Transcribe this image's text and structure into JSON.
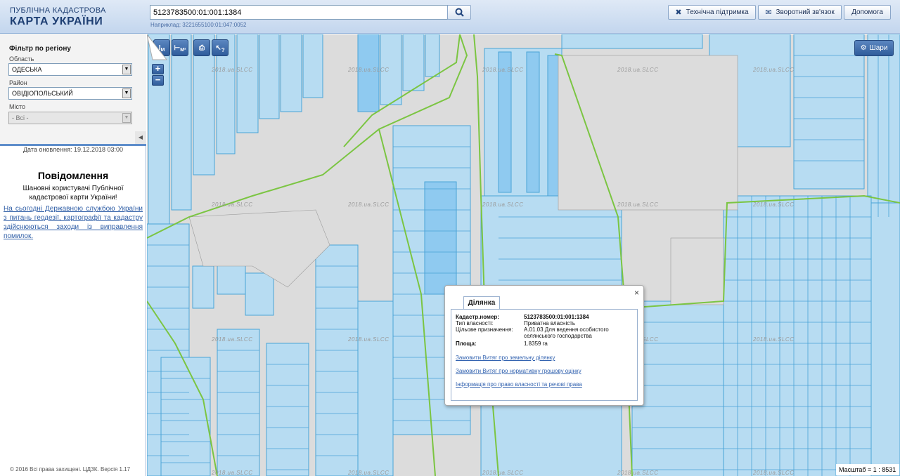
{
  "header": {
    "logo_line1": "ПУБЛІЧНА КАДАСТРОВА",
    "logo_line2": "КАРТА УКРАЇНИ",
    "search_value": "5123783500:01:001:1384",
    "search_hint": "Наприклад: 3221655100:01:047:0052",
    "buttons": {
      "support": "Технічна підтримка",
      "feedback": "Зворотний зв'язок",
      "help": "Допомога"
    }
  },
  "sidebar": {
    "filter_title": "Фільтр по регіону",
    "region_label": "Область",
    "region_value": "ОДЕСЬКА",
    "district_label": "Район",
    "district_value": "ОВІДІОПОЛЬСЬКИЙ",
    "city_label": "Місто",
    "city_value": "- Всі -",
    "update_date": "Дата оновлення: 19.12.2018 03:00",
    "message_title": "Повідомлення",
    "message_body": "Шановні користувачі Публічної кадастрової карти України!",
    "message_link": "На сьогодні Державною службою України з питань геодезії, картографії та кадастру здійснюються заходи із виправлення помилок.",
    "copyright": "© 2016 Всі права захищені. ЦДЗК. Версія 1.17"
  },
  "map": {
    "tools": {
      "measure_line_label": "M",
      "measure_area_label": "M²",
      "info_label": "?"
    },
    "zoom_in": "+",
    "zoom_out": "−",
    "layers_label": "Шари",
    "scale_text": "Масштаб = 1 : 8531",
    "watermark": "2018.ua.SLCC"
  },
  "popup": {
    "tab_label": "Ділянка",
    "close": "×",
    "fields": {
      "cadastral_label": "Кадастр.номер:",
      "cadastral_value": "5123783500:01:001:1384",
      "ownership_label": "Тип власності:",
      "ownership_value": "Приватна власність",
      "purpose_label": "Цільове призначення:",
      "purpose_value": "А.01.03 Для ведення особистого селянського господарства",
      "area_label": "Площа:",
      "area_value": "1.8359 га"
    },
    "links": {
      "extract": "Замовити Витяг про земельну ділянку",
      "valuation": "Замовити Витяг про нормативну грошову оцінку",
      "rights": "Інформація про право власності та речові права"
    }
  }
}
